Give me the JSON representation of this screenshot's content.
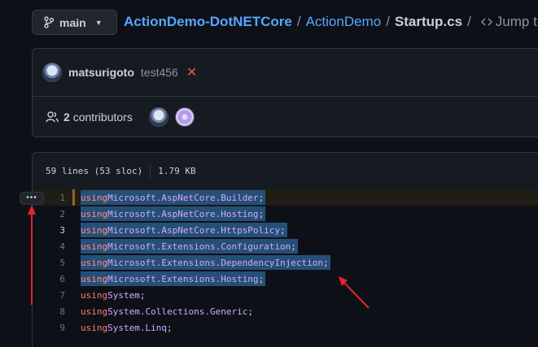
{
  "branch": {
    "label": "main"
  },
  "breadcrumb": {
    "repo": "ActionDemo-DotNETCore",
    "sep1": "/",
    "dir": "ActionDemo",
    "sep2": "/",
    "file": "Startup.cs",
    "sep3": "/",
    "jump": "Jump to"
  },
  "commit": {
    "author": "matsurigoto",
    "message": "test456",
    "status_icon": "x-fail-icon"
  },
  "contributors": {
    "count": "2",
    "label": "contributors"
  },
  "file_info": {
    "lines": "59 lines (53 sloc)",
    "size": "1.79 KB"
  },
  "lines_menu": {
    "label": "•••"
  },
  "code": [
    {
      "num": "1",
      "kw": "using",
      "ns": "Microsoft.AspNetCore.Builder",
      "end": ";"
    },
    {
      "num": "2",
      "kw": "using",
      "ns": "Microsoft.AspNetCore.Hosting",
      "end": ";"
    },
    {
      "num": "3",
      "kw": "using",
      "ns": "Microsoft.AspNetCore.HttpsPolicy",
      "end": ";"
    },
    {
      "num": "4",
      "kw": "using",
      "ns": "Microsoft.Extensions.Configuration",
      "end": ";"
    },
    {
      "num": "5",
      "kw": "using",
      "ns": "Microsoft.Extensions.DependencyInjection",
      "end": ";"
    },
    {
      "num": "6",
      "kw": "using",
      "ns": "Microsoft.Extensions.Hosting",
      "end": ";"
    },
    {
      "num": "7",
      "kw": "using",
      "ns": "System",
      "end": ";"
    },
    {
      "num": "8",
      "kw": "using",
      "ns": "System.Collections.Generic",
      "end": ";"
    },
    {
      "num": "9",
      "kw": "using",
      "ns": "System.Linq",
      "end": ";"
    }
  ],
  "colors": {
    "link": "#58a6ff",
    "selection": "#264f78",
    "annotation_arrow": "#e5242b"
  }
}
